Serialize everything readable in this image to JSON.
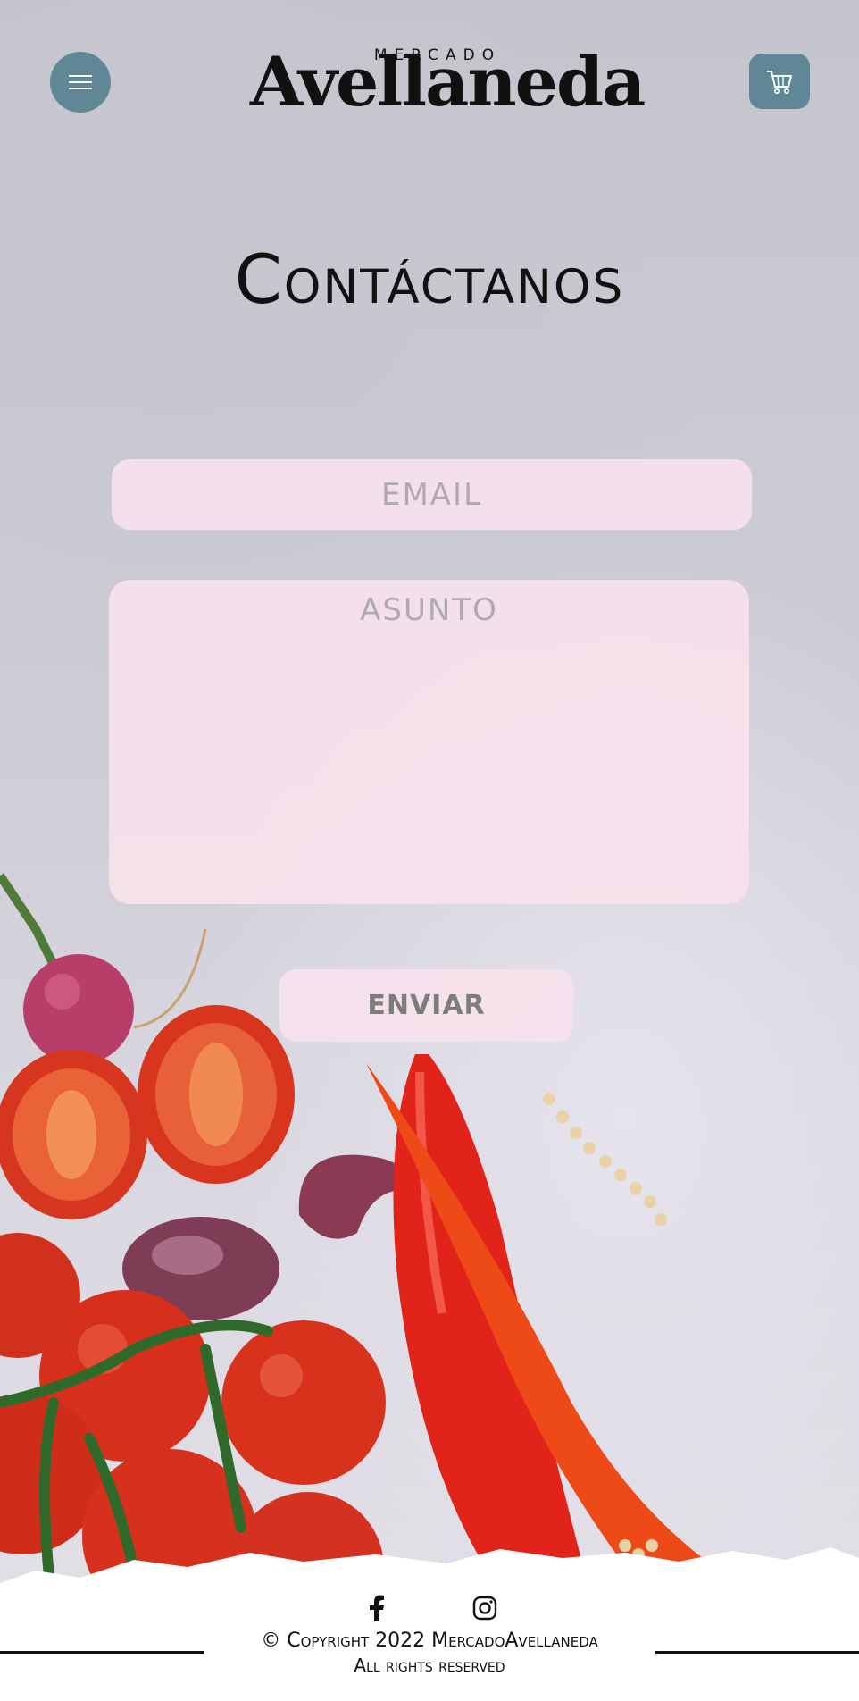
{
  "brand": {
    "top": "MERCADO",
    "name": "Avellaneda"
  },
  "header": {
    "menu_icon": "menu-icon",
    "cart_icon": "cart-icon"
  },
  "page": {
    "title": "Contáctanos"
  },
  "form": {
    "email_placeholder": "EMAIL",
    "subject_placeholder": "ASUNTO",
    "send_label": "ENVIAR"
  },
  "footer": {
    "social": [
      "facebook-icon",
      "instagram-icon"
    ],
    "copyright": "© Copyright 2022 MercadoAvellaneda",
    "rights": "All rights reserved"
  },
  "colors": {
    "accent": "#5f8796",
    "field_bg": "#f6e2ec",
    "text": "#111111"
  }
}
